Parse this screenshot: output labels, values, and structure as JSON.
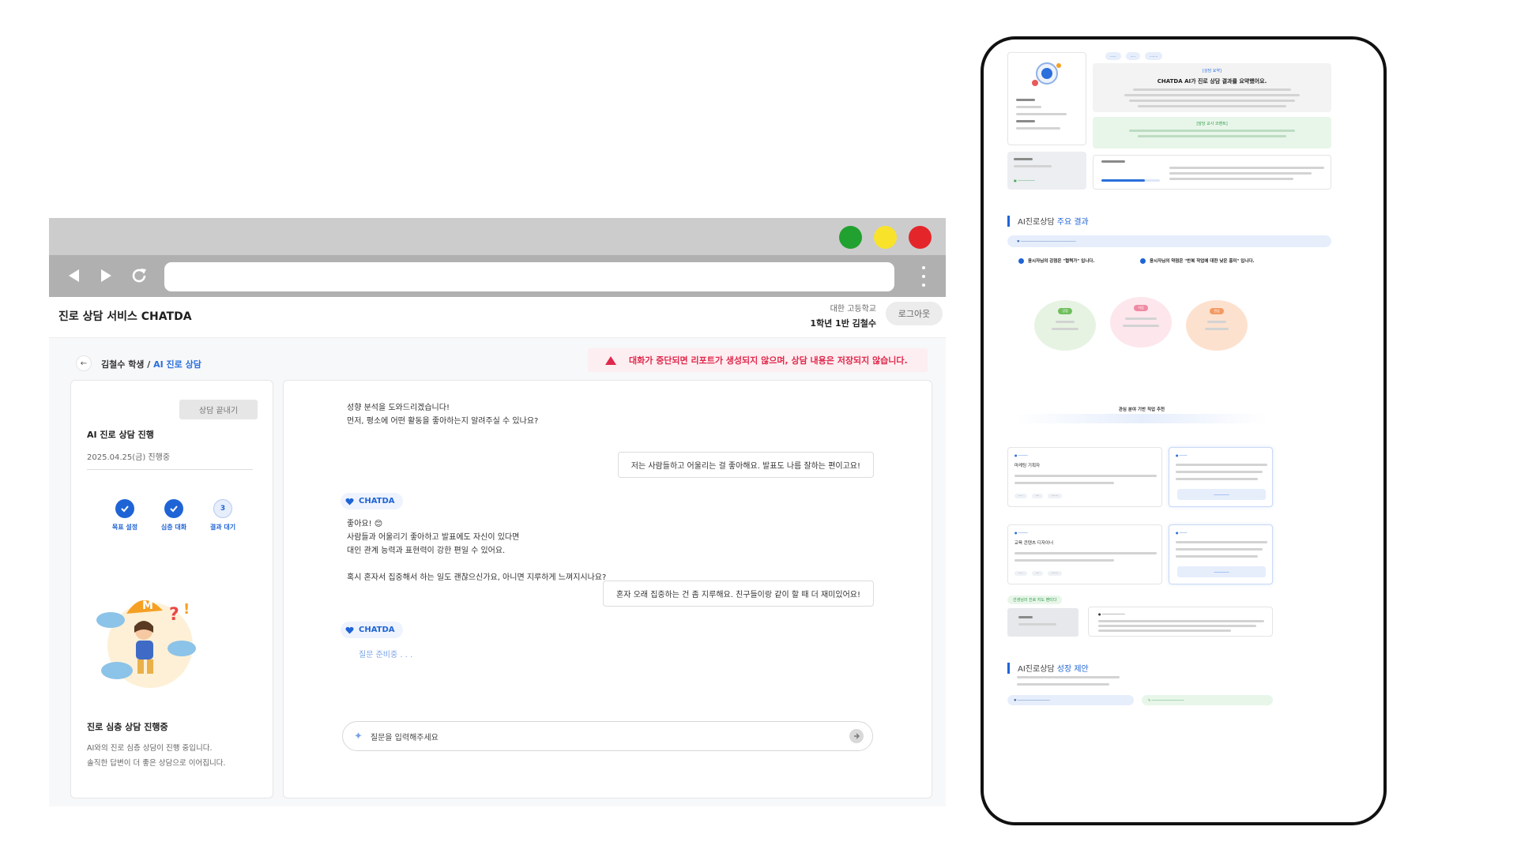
{
  "browser": {
    "controls": {
      "back": "back-arrow",
      "forward": "forward-arrow",
      "reload": "reload-icon",
      "menu": "kebab-menu"
    },
    "traffic_lights": [
      "#21a12f",
      "#f8e32a",
      "#e4262a"
    ],
    "url": ""
  },
  "app": {
    "title": "진로 상담 서비스 CHATDA",
    "school": "대한 고등학교",
    "student": "1학년 1반 김철수",
    "logout_label": "로그아웃"
  },
  "breadcrumb": {
    "student": "김철수 학생 / ",
    "current": "AI 진로 상담"
  },
  "warning": "대화가 중단되면 리포트가 생성되지 않으며, 상담 내용은 저장되지 않습니다.",
  "sidebar": {
    "end_button": "상담 끝내기",
    "title": "AI 진로 상담 진행",
    "date": "2025.04.25(금) 진행중",
    "steps": [
      {
        "label": "목표 설정",
        "state": "done"
      },
      {
        "label": "심층 대화",
        "state": "done"
      },
      {
        "number": "3",
        "label": "결과 대기",
        "state": "pending"
      }
    ],
    "caption_title": "진로 심층 상담 진행중",
    "caption_line1": "AI와의 진로 심층 상담이 진행 중입니다.",
    "caption_line2": "솔직한 답변이 더 좋은 상담으로 이어집니다."
  },
  "chat": {
    "messages": [
      {
        "role": "bot",
        "text": "성향 분석을 도와드리겠습니다!\n먼저, 평소에 어떤 활동을 좋아하는지 알려주실 수 있나요?"
      },
      {
        "role": "user",
        "text": "저는 사람들하고 어울리는 걸 좋아해요. 발표도 나름 잘하는 편이고요!"
      },
      {
        "role": "bot_tag",
        "text": "CHATDA"
      },
      {
        "role": "bot",
        "text": "좋아요! 😊\n사람들과 어울리기 좋아하고 발표에도 자신이 있다면\n대인 관계 능력과 표현력이 강한 편일 수 있어요.\n\n혹시 혼자서 집중해서 하는 일도 괜찮으신가요, 아니면 지루하게 느껴지시나요?"
      },
      {
        "role": "user",
        "text": "혼자 오래 집중하는 건 좀 지루해요. 친구들이랑 같이 할 때 더 재미있어요!"
      },
      {
        "role": "bot_tag",
        "text": "CHATDA"
      }
    ],
    "typing": "질문 준비중 . . .",
    "input_placeholder": "질문을 입력해주세요"
  },
  "report": {
    "chips": [
      "",
      "",
      ""
    ],
    "summary_head": "[상담 요약]",
    "summary_title": "CHATDA AI가 진로 상담 결과를 요약했어요.",
    "teacher_head": "[담당 교사 코멘트]",
    "section1_prefix": "AI진로상담 ",
    "section1_highlight": "주요 결과",
    "strength": "윤시자님의 강점은 \"협력가\" 입니다.",
    "weakness": "윤시자님의 약점은 \"반복 작업에 대한 낮은 흥미\" 입니다.",
    "bubbles": [
      "강점",
      "약점",
      "관심"
    ],
    "center_title": "관심 분야 기반 직업 추천",
    "job1": "마케팅 기획자",
    "job2": "교육 콘텐츠 디자이너",
    "mentor_chip": "선생님의 진로 지도 멘티다",
    "section2_prefix": "AI진로상담 ",
    "section2_highlight": "성장 제안"
  }
}
